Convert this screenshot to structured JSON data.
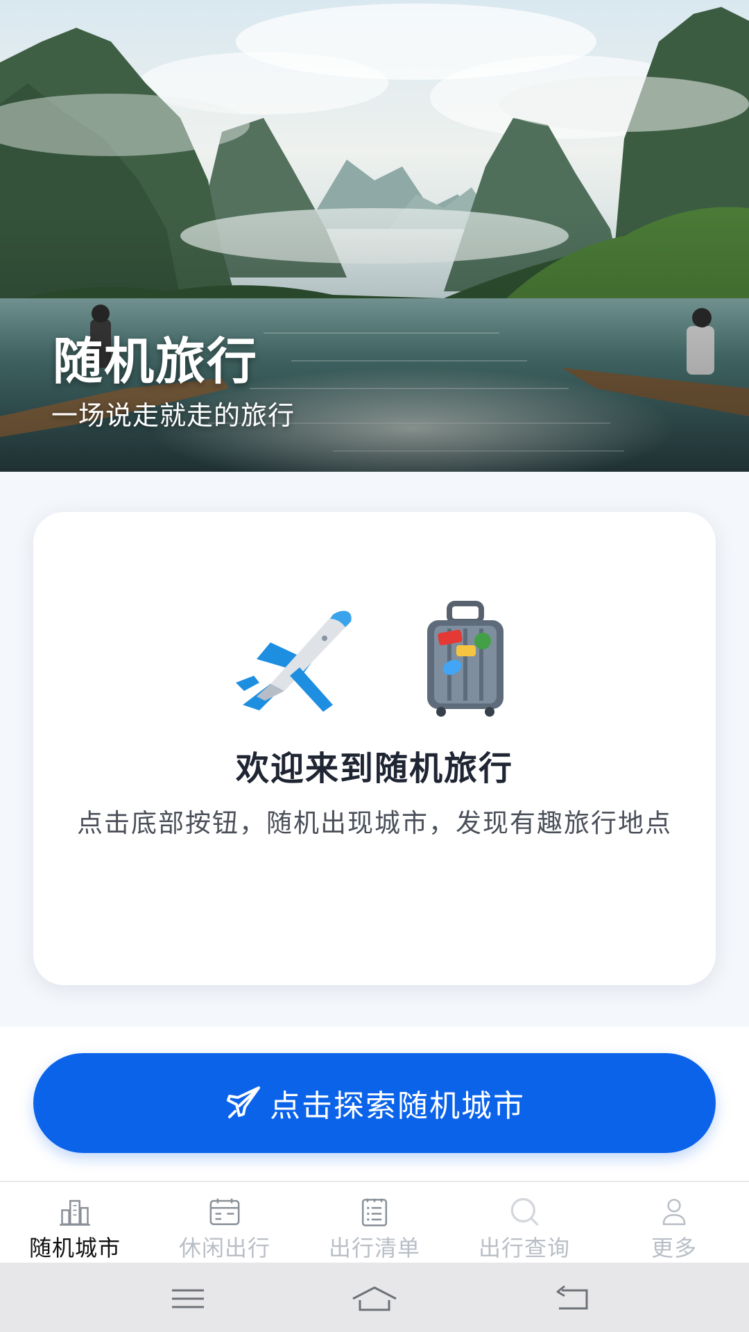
{
  "hero": {
    "title": "随机旅行",
    "subtitle": "一场说走就走的旅行"
  },
  "welcome_card": {
    "icons": [
      "airplane-icon",
      "luggage-icon"
    ],
    "title": "欢迎来到随机旅行",
    "description": "点击底部按钮，随机出现城市，发现有趣旅行地点"
  },
  "cta": {
    "icon": "paper-plane-icon",
    "label": "点击探索随机城市",
    "color": "#0b63ea"
  },
  "tabbar": {
    "items": [
      {
        "label": "随机城市",
        "icon": "city-buildings-icon",
        "active": true
      },
      {
        "label": "休闲出行",
        "icon": "calendar-icon",
        "active": false
      },
      {
        "label": "出行清单",
        "icon": "checklist-icon",
        "active": false
      },
      {
        "label": "出行查询",
        "icon": "search-icon",
        "active": false
      },
      {
        "label": "更多",
        "icon": "user-icon",
        "active": false
      }
    ],
    "active_color": "#111111",
    "inactive_color": "#b9bec6"
  },
  "system_nav": {
    "buttons": [
      "menu-icon",
      "home-icon",
      "back-icon"
    ]
  }
}
